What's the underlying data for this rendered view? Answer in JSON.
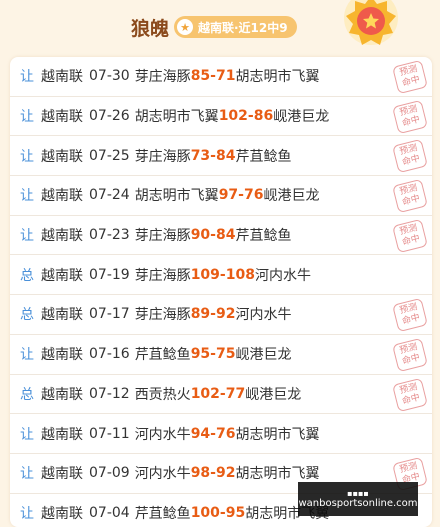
{
  "header": {
    "title": "狼魄",
    "badge_icon": "star-icon",
    "badge_text": "越南联·近12中9"
  },
  "stamp_text": [
    "预测",
    "命中"
  ],
  "rows": [
    {
      "tag": "让",
      "league": "越南联",
      "date": "07-30",
      "home": "芽庄海豚",
      "home_score": "85",
      "sep": " - ",
      "away_score": "71",
      "away": "胡志明市飞翼",
      "hit": true
    },
    {
      "tag": "让",
      "league": "越南联",
      "date": "07-26",
      "home": "胡志明市飞翼",
      "home_score": "102",
      "sep": " - ",
      "away_score": "86",
      "away": "岘港巨龙",
      "hit": true
    },
    {
      "tag": "让",
      "league": "越南联",
      "date": "07-25",
      "home": "芽庄海豚",
      "home_score": "73",
      "sep": " - ",
      "away_score": "84",
      "away": "芹苴鲶鱼",
      "hit": true
    },
    {
      "tag": "让",
      "league": "越南联",
      "date": "07-24",
      "home": "胡志明市飞翼",
      "home_score": "97",
      "sep": " - ",
      "away_score": "76",
      "away": "岘港巨龙",
      "hit": true
    },
    {
      "tag": "让",
      "league": "越南联",
      "date": "07-23",
      "home": "芽庄海豚",
      "home_score": "90",
      "sep": " - ",
      "away_score": "84",
      "away": "芹苴鲶鱼",
      "hit": true
    },
    {
      "tag": "总",
      "league": "越南联",
      "date": "07-19",
      "home": "芽庄海豚",
      "home_score": "109",
      "sep": " - ",
      "away_score": "108",
      "away": "河内水牛",
      "hit": false
    },
    {
      "tag": "总",
      "league": "越南联",
      "date": "07-17",
      "home": "芽庄海豚",
      "home_score": "89",
      "sep": " - ",
      "away_score": "92",
      "away": "河内水牛",
      "hit": true
    },
    {
      "tag": "让",
      "league": "越南联",
      "date": "07-16",
      "home": "芹苴鲶鱼",
      "home_score": "95",
      "sep": " - ",
      "away_score": "75",
      "away": "岘港巨龙",
      "hit": true
    },
    {
      "tag": "总",
      "league": "越南联",
      "date": "07-12",
      "home": "西贡热火",
      "home_score": "102",
      "sep": " - ",
      "away_score": "77",
      "away": "岘港巨龙",
      "hit": true
    },
    {
      "tag": "让",
      "league": "越南联",
      "date": "07-11",
      "home": "河内水牛",
      "home_score": "94",
      "sep": " - ",
      "away_score": "76",
      "away": "胡志明市飞翼",
      "hit": false
    },
    {
      "tag": "让",
      "league": "越南联",
      "date": "07-09",
      "home": "河内水牛",
      "home_score": "98",
      "sep": " - ",
      "away_score": "92",
      "away": "胡志明市飞翼",
      "hit": true
    },
    {
      "tag": "让",
      "league": "越南联",
      "date": "07-04",
      "home": "芹苴鲶鱼",
      "home_score": "100",
      "sep": " - ",
      "away_score": "95",
      "away": "胡志明市飞翼",
      "hit": false
    }
  ],
  "watermark": {
    "top": "▪▪▪▪",
    "text": "wanbosportsonline.com"
  }
}
